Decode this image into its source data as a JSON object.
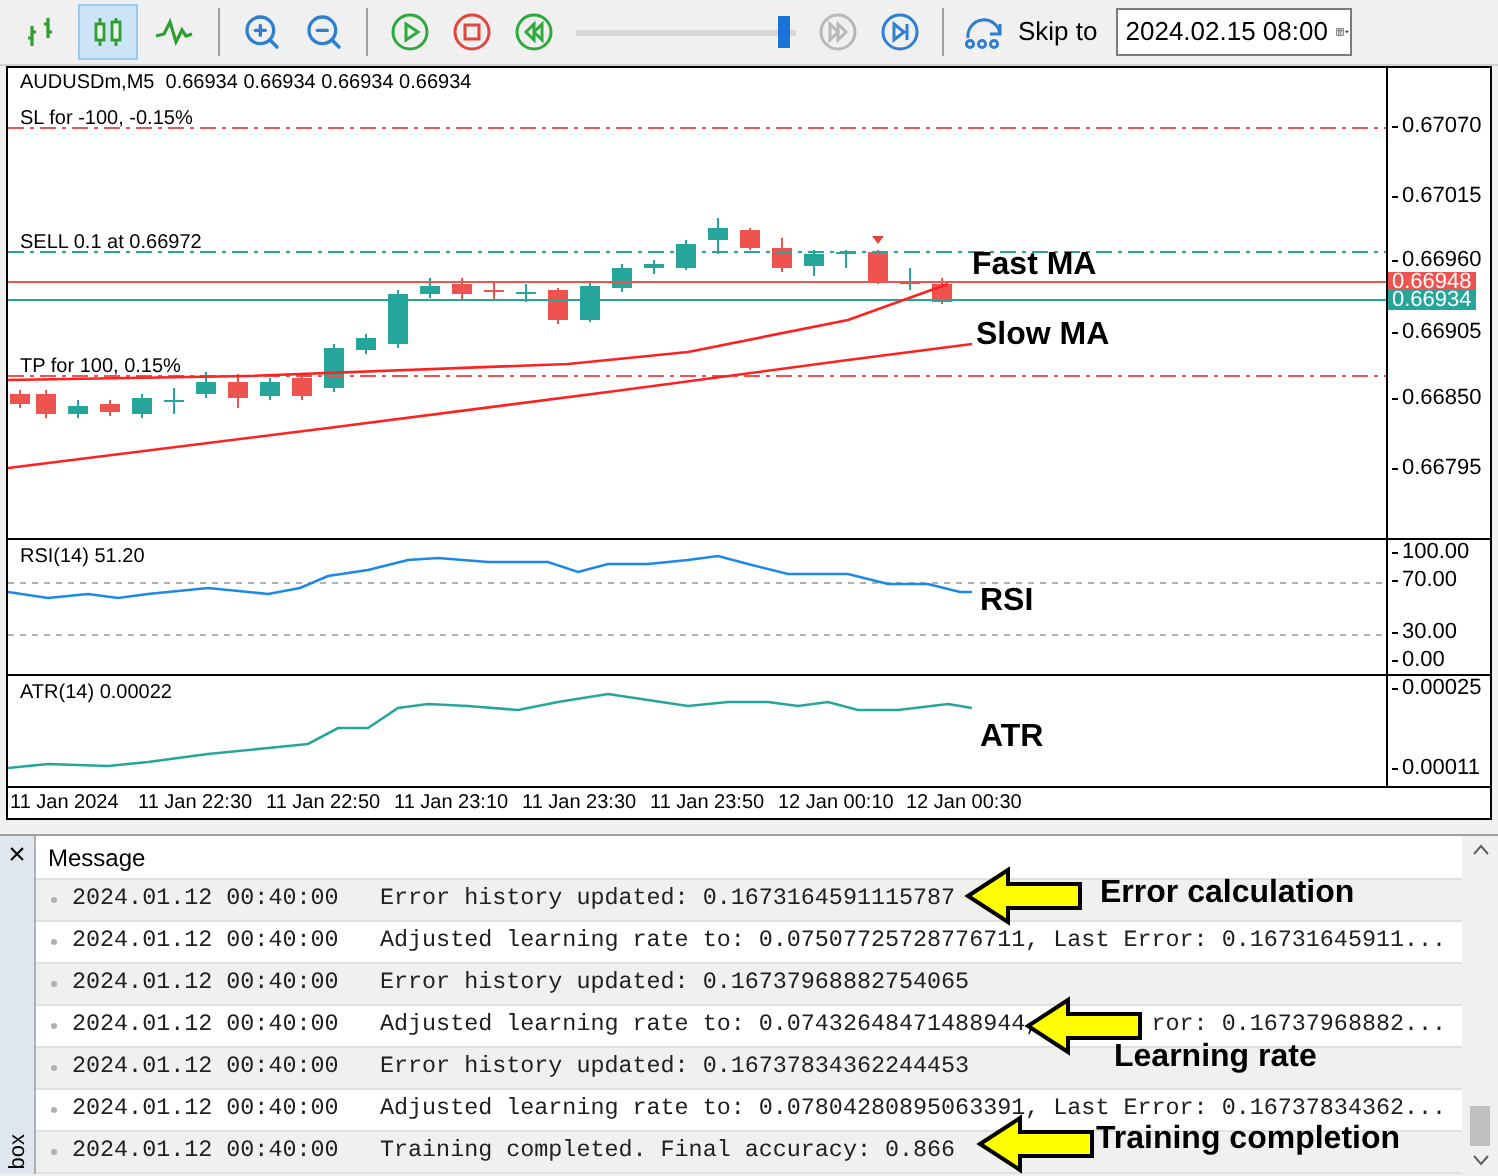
{
  "toolbar": {
    "chart_types": [
      {
        "kind": "bars",
        "selected": false
      },
      {
        "kind": "candles",
        "selected": true
      },
      {
        "kind": "line",
        "selected": false
      }
    ],
    "speed_slider": {
      "level": 0.97
    },
    "fast_forward": {
      "disabled": true
    },
    "skip_to": {
      "label": "Skip to",
      "value": "2024.02.15 08:00"
    }
  },
  "chart": {
    "title": "AUDUSDm,M5  0.66934 0.66934 0.66934 0.66934",
    "level_lines": [
      {
        "kind": "sl",
        "label": "SL for -100, -0.15%"
      },
      {
        "kind": "entry",
        "label": "SELL 0.1 at 0.66972"
      },
      {
        "kind": "tp",
        "label": "TP for 100, 0.15%"
      }
    ],
    "price_axis": [
      "0.67070",
      "0.67015",
      "0.66960",
      "0.66905",
      "0.66850",
      "0.66795"
    ],
    "price_badges": [
      {
        "text": "0.66948",
        "color": "#ef5350"
      },
      {
        "text": "0.66934",
        "color": "#26a69a"
      }
    ],
    "callouts": [
      "Fast MA",
      "Slow MA"
    ]
  },
  "rsi": {
    "title": "RSI(14) 51.20",
    "axis": [
      "100.00",
      "70.00",
      "30.00",
      "0.00"
    ],
    "callout": "RSI"
  },
  "atr": {
    "title": "ATR(14) 0.00022",
    "axis": [
      "0.00025",
      "0.00011"
    ],
    "callout": "ATR"
  },
  "time_axis": [
    "11 Jan 2024",
    "11 Jan 22:30",
    "11 Jan 22:50",
    "11 Jan 23:10",
    "11 Jan 23:30",
    "11 Jan 23:50",
    "12 Jan 00:10",
    "12 Jan 00:30"
  ],
  "log": {
    "close": "×",
    "side_tab": "box",
    "header": "Message",
    "rows": [
      {
        "time": "2024.01.12 00:40:00",
        "parts": [
          "Error history updated: 0.1673164591115787"
        ]
      },
      {
        "time": "2024.01.12 00:40:00",
        "parts": [
          "Adjusted learning rate to: 0.07507725728776711, Last Error: 0.16731645911..."
        ]
      },
      {
        "time": "2024.01.12 00:40:00",
        "parts": [
          "Error history updated: 0.16737968882754065"
        ]
      },
      {
        "time": "2024.01.12 00:40:00",
        "parts": [
          "Adjusted learning rate to: 0.07432648471488944,",
          "ror: 0.16737968882..."
        ]
      },
      {
        "time": "2024.01.12 00:40:00",
        "parts": [
          "Error history updated: 0.16737834362244453"
        ]
      },
      {
        "time": "2024.01.12 00:40:00",
        "parts": [
          "Adjusted learning rate to: 0.07804280895063391, Last Error: 0.16737834362..."
        ]
      },
      {
        "time": "2024.01.12 00:40:00",
        "parts": [
          "Training completed. Final accuracy: 0.866"
        ]
      }
    ]
  },
  "annotations": [
    "Error calculation",
    "Learning rate",
    "Training completion"
  ]
}
